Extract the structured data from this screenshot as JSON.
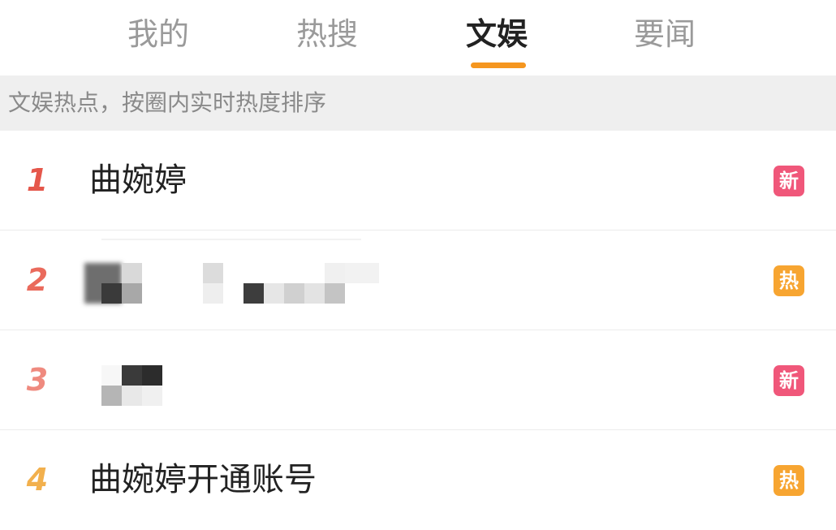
{
  "tabs": [
    {
      "label": "我的",
      "active": false
    },
    {
      "label": "热搜",
      "active": false
    },
    {
      "label": "文娱",
      "active": true
    },
    {
      "label": "要闻",
      "active": false
    }
  ],
  "banner": {
    "text": "文娱热点，按圈内实时热度排序"
  },
  "list": {
    "items": [
      {
        "rank": "1",
        "title": "曲婉婷",
        "badge": "新",
        "badge_type": "new",
        "obscured": false
      },
      {
        "rank": "2",
        "title": "",
        "badge": "热",
        "badge_type": "hot",
        "obscured": true
      },
      {
        "rank": "3",
        "title": "",
        "badge": "新",
        "badge_type": "new",
        "obscured": true
      },
      {
        "rank": "4",
        "title": "曲婉婷开通账号",
        "badge": "热",
        "badge_type": "hot",
        "obscured": false
      }
    ]
  },
  "colors": {
    "accent": "#f5961f",
    "badge_new": "#f0577a",
    "badge_hot": "#f7a531"
  }
}
